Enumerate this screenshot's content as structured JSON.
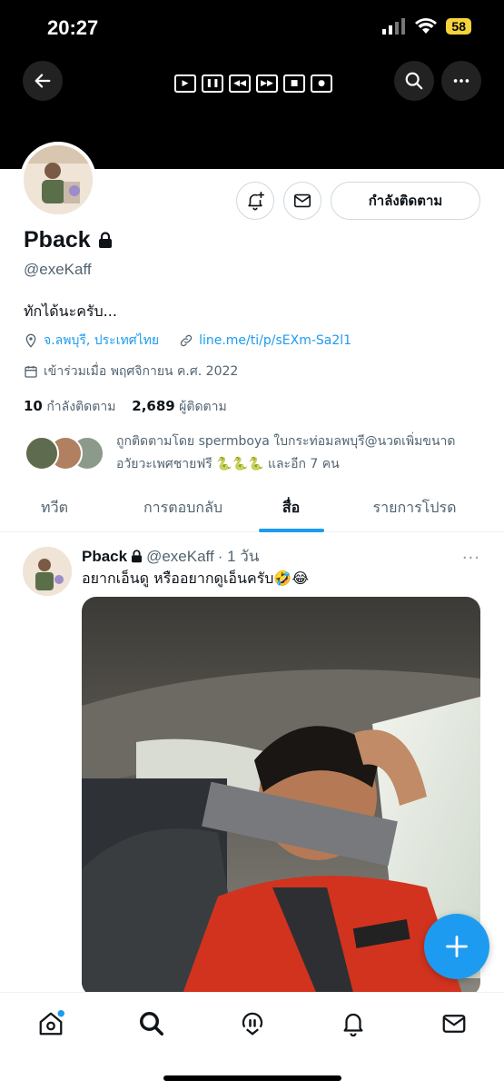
{
  "status_bar": {
    "time": "20:27",
    "battery": "58"
  },
  "profile": {
    "name": "Pback",
    "handle": "@exeKaff",
    "bio": "ทักได้นะครับ...",
    "location": "จ.ลพบุรี, ประเทศไทย",
    "website": "line.me/ti/p/sEXm-Sa2l1",
    "joined": "เข้าร่วมเมื่อ พฤศจิกายน ค.ศ. 2022",
    "following_count": "10",
    "following_label": "กำลังติดตาม",
    "followers_count": "2,689",
    "followers_label": "ผู้ติดตาม",
    "followed_by_line1": "ถูกติดตามโดย spermboya ใบกระท่อมลพบุรี@นวดเพิ่มขนาด",
    "followed_by_line2": "อวัยวะเพศชายฟรี 🐍🐍🐍 และอีก 7 คน",
    "following_button": "กำลังติดตาม"
  },
  "tabs": [
    {
      "label": "ทวีต"
    },
    {
      "label": "การตอบกลับ"
    },
    {
      "label": "สื่อ"
    },
    {
      "label": "รายการโปรด"
    }
  ],
  "active_tab": "สื่อ",
  "tweet": {
    "name": "Pback",
    "handle": "@exeKaff",
    "time": "· 1 วัน",
    "text": "อยากเอ็นดู หรืออยากดูเอ็นครับ🤣😂",
    "more": "···"
  },
  "colors": {
    "accent": "#1d9bf0",
    "header_bg": "#000000",
    "text": "#0f1419",
    "muted": "#536471"
  },
  "icons": [
    "back-arrow-icon",
    "search-icon",
    "more-icon",
    "notify-add-icon",
    "mail-icon",
    "lock-icon",
    "location-icon",
    "link-icon",
    "calendar-icon",
    "home-icon",
    "spaces-icon",
    "bell-icon",
    "compose-plus-icon"
  ]
}
